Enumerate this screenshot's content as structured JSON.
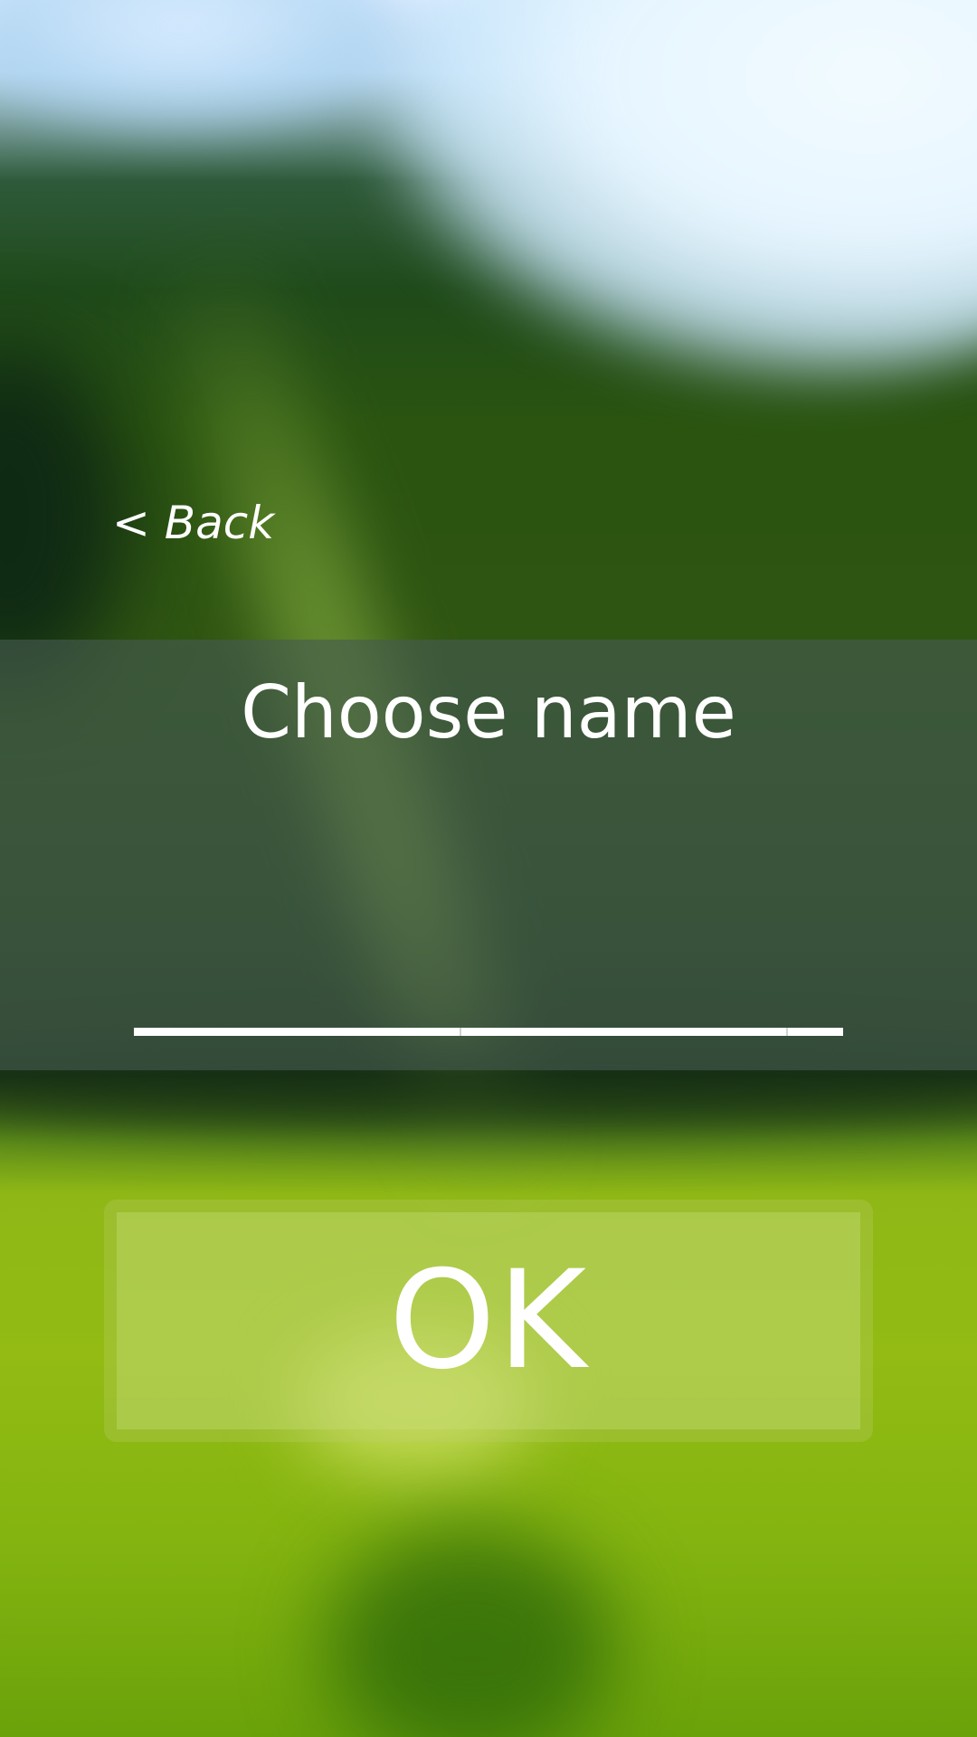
{
  "back": {
    "label": "< Back"
  },
  "dialog": {
    "title": "Choose name",
    "name_input": {
      "value": "",
      "placeholder": ""
    }
  },
  "ok_button": {
    "label": "OK"
  },
  "colors": {
    "text": "#ffffff",
    "panel": "#465a50",
    "input_underline": "#ffffff"
  }
}
